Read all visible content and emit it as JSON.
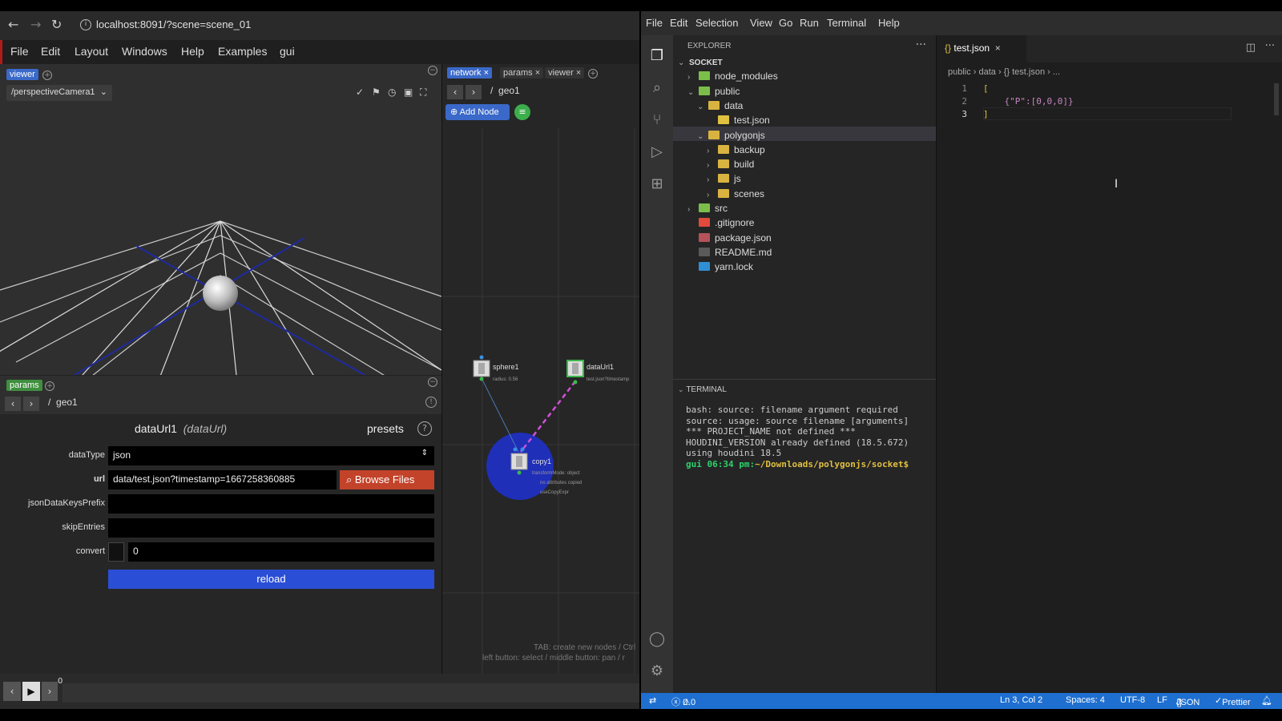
{
  "browser": {
    "url": "localhost:8091/?scene=scene_01",
    "menu": [
      "File",
      "Edit",
      "Layout",
      "Windows",
      "Help",
      "Examples",
      "gui"
    ],
    "viewer_tag": "viewer",
    "camera": "/perspectiveCamera1",
    "params_tag": "params",
    "params_path": "geo1",
    "node_name": "dataUrl1",
    "node_type": "(dataUrl)",
    "presets_label": "presets",
    "params": {
      "dataType_label": "dataType",
      "dataType_value": "json",
      "url_label": "url",
      "url_value": "data/test.json?timestamp=1667258360885",
      "browse_label": "Browse Files",
      "jsonDataKeysPrefix_label": "jsonDataKeysPrefix",
      "skipEntries_label": "skipEntries",
      "convert_label": "convert",
      "convert_value": "0",
      "reload_label": "reload"
    },
    "timeline_frame": "0",
    "network": {
      "tabs": [
        "network",
        "params",
        "viewer"
      ],
      "path": "geo1",
      "add_node_label": "Add Node",
      "nodes": {
        "sphere_name": "sphere1",
        "sphere_info": "radius: 0.56",
        "dataurl_name": "dataUrl1",
        "dataurl_info": "test.json?timestamp",
        "copy_name": "copy1",
        "copy_info1": "transformMode: object",
        "copy_info2": "no attributes copied",
        "copy_info3": "useCopyExpr"
      },
      "hint1": "TAB: create new nodes / Ctrl",
      "hint2": "left button: select / middle button: pan / r"
    }
  },
  "vscode": {
    "menu": [
      "File",
      "Edit",
      "Selection",
      "View",
      "Go",
      "Run",
      "Terminal",
      "Help"
    ],
    "explorer_title": "EXPLORER",
    "tree": [
      {
        "label": "SOCKET",
        "depth": 0,
        "expanded": true,
        "kind": "root"
      },
      {
        "label": "node_modules",
        "depth": 1,
        "expanded": false,
        "kind": "folder-green"
      },
      {
        "label": "public",
        "depth": 1,
        "expanded": true,
        "kind": "folder-green"
      },
      {
        "label": "data",
        "depth": 2,
        "expanded": true,
        "kind": "folder-yellow"
      },
      {
        "label": "test.json",
        "depth": 3,
        "kind": "json",
        "selected": true
      },
      {
        "label": "polygonjs",
        "depth": 2,
        "expanded": true,
        "kind": "folder-yellow"
      },
      {
        "label": "backup",
        "depth": 3,
        "expanded": false,
        "kind": "folder-yellow"
      },
      {
        "label": "build",
        "depth": 3,
        "expanded": false,
        "kind": "folder-yellow"
      },
      {
        "label": "js",
        "depth": 3,
        "expanded": false,
        "kind": "folder-yellow"
      },
      {
        "label": "scenes",
        "depth": 3,
        "expanded": false,
        "kind": "folder-yellow"
      },
      {
        "label": "src",
        "depth": 1,
        "expanded": false,
        "kind": "folder-green"
      },
      {
        "label": ".gitignore",
        "depth": 1,
        "kind": "git"
      },
      {
        "label": "package.json",
        "depth": 1,
        "kind": "pkg"
      },
      {
        "label": "README.md",
        "depth": 1,
        "kind": "md"
      },
      {
        "label": "yarn.lock",
        "depth": 1,
        "kind": "yarn"
      }
    ],
    "terminal_title": "TERMINAL",
    "terminal_lines": [
      "bash: source: filename argument required",
      "source: usage: source filename [arguments]",
      "*** PROJECT_NAME not defined ***",
      "HOUDINI_VERSION already defined (18.5.672)",
      "using houdini 18.5"
    ],
    "terminal_prompt_user": "gui 06:34 pm:",
    "terminal_prompt_path": "~/Downloads/polygonjs/socket$",
    "editor_tab": "test.json",
    "breadcrumb": "public › data › {} test.json › ...",
    "code": [
      "[",
      "    {\"P\":[0,0,0]}",
      "]"
    ],
    "status": {
      "errors": "0",
      "warnings": "0",
      "position": "Ln 3, Col 2",
      "spaces": "Spaces: 4",
      "encoding": "UTF-8",
      "eol": "LF",
      "language": "JSON",
      "prettier": "Prettier"
    }
  }
}
